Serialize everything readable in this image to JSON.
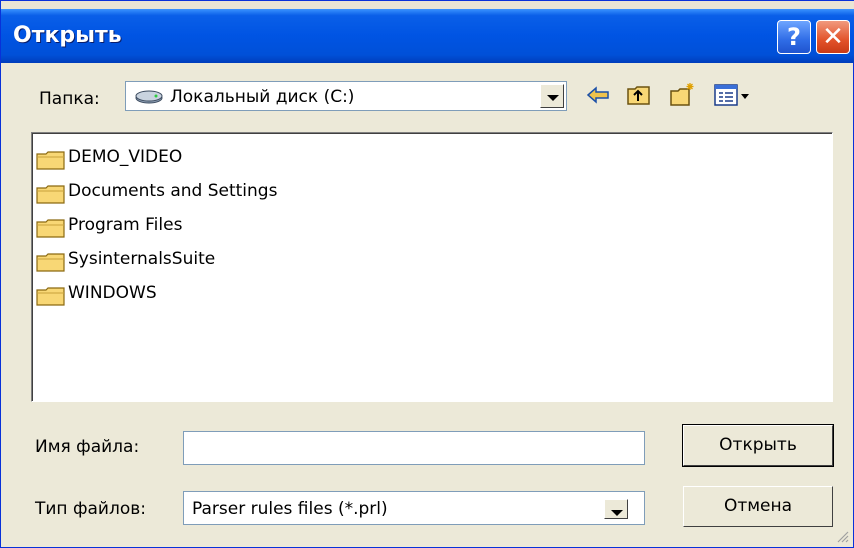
{
  "window": {
    "title": "Открыть",
    "help_label": "?",
    "close_label": "✕"
  },
  "lookin": {
    "label": "Папка:",
    "value": "Локальный диск (C:)"
  },
  "toolbar": {
    "back_icon": "back-arrow-icon",
    "up_icon": "up-folder-icon",
    "new_folder_icon": "new-folder-icon",
    "view_icon": "view-menu-icon"
  },
  "files": [
    {
      "name": "DEMO_VIDEO"
    },
    {
      "name": "Documents and Settings"
    },
    {
      "name": "Program Files"
    },
    {
      "name": "SysinternalsSuite"
    },
    {
      "name": "WINDOWS"
    }
  ],
  "filename": {
    "label": "Имя файла:",
    "value": ""
  },
  "filetype": {
    "label": "Тип файлов:",
    "value": "Parser rules files (*.prl)"
  },
  "buttons": {
    "open": "Открыть",
    "cancel": "Отмена"
  },
  "colors": {
    "titlebar": "#0054e3",
    "window_bg": "#ece9d8",
    "folder": "#f8d775"
  }
}
